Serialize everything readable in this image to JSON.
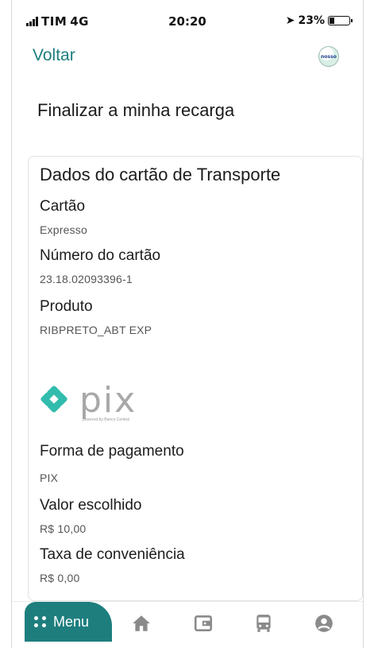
{
  "status_bar": {
    "carrier": "TIM",
    "network": "4G",
    "time": "20:20",
    "battery": "23%"
  },
  "header": {
    "back_label": "Voltar",
    "logo_text": "nosso"
  },
  "page": {
    "title": "Finalizar a minha recarga"
  },
  "card": {
    "title": "Dados do cartão de Transporte",
    "fields": [
      {
        "label": "Cartão",
        "value": "Expresso"
      },
      {
        "label": "Número do cartão",
        "value": "23.18.02093396-1"
      },
      {
        "label": "Produto",
        "value": "RIBPRETO_ABT EXP"
      }
    ],
    "pix": {
      "word": "pix",
      "subtitle": "powered by Banco Central"
    },
    "payment": [
      {
        "label": "Forma de pagamento",
        "value": "PIX"
      },
      {
        "label": "Valor escolhido",
        "value": "R$  10,00"
      },
      {
        "label": "Taxa de conveniência",
        "value": "R$  0,00"
      }
    ]
  },
  "bottom_nav": {
    "menu_label": "Menu",
    "items": [
      "home-icon",
      "wallet-icon",
      "bus-icon",
      "user-icon"
    ],
    "accent_color": "#1e7e7e",
    "icon_color": "#8a8a8a"
  }
}
